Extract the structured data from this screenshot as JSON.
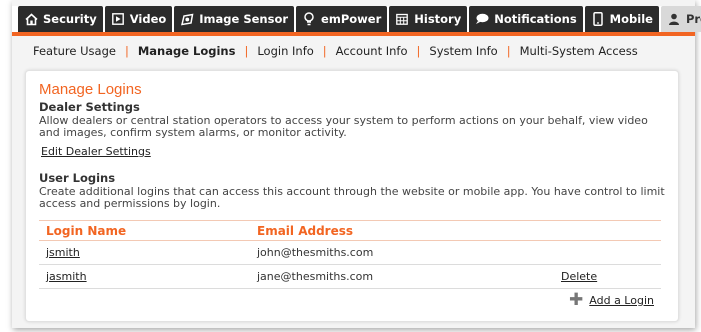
{
  "tabs": [
    {
      "label": "Security",
      "icon": "home-icon",
      "active": false
    },
    {
      "label": "Video",
      "icon": "play-icon",
      "active": false
    },
    {
      "label": "Image Sensor",
      "icon": "camera-icon",
      "active": false
    },
    {
      "label": "emPower",
      "icon": "bulb-icon",
      "active": false
    },
    {
      "label": "History",
      "icon": "calendar-icon",
      "active": false
    },
    {
      "label": "Notifications",
      "icon": "chat-bubble-icon",
      "active": false
    },
    {
      "label": "Mobile",
      "icon": "phone-icon",
      "active": false
    },
    {
      "label": "Profile",
      "icon": "person-icon",
      "active": true
    }
  ],
  "subnav": [
    {
      "label": "Feature Usage",
      "active": false
    },
    {
      "label": "Manage Logins",
      "active": true
    },
    {
      "label": "Login Info",
      "active": false
    },
    {
      "label": "Account Info",
      "active": false
    },
    {
      "label": "System Info",
      "active": false
    },
    {
      "label": "Multi-System Access",
      "active": false
    }
  ],
  "page": {
    "title": "Manage Logins",
    "dealer": {
      "heading": "Dealer Settings",
      "description": "Allow dealers or central station operators to access your system to perform actions on your behalf, view video and images, confirm system alarms, or monitor activity.",
      "edit_link": "Edit Dealer Settings"
    },
    "users": {
      "heading": "User Logins",
      "description": "Create additional logins that can access this account through the website or mobile app. You have control to limit access and permissions by login."
    }
  },
  "table": {
    "headers": [
      "Login Name",
      "Email Address",
      ""
    ],
    "rows": [
      {
        "login": "jsmith",
        "email": "john@thesmiths.com",
        "action": ""
      },
      {
        "login": "jasmith",
        "email": "jane@thesmiths.com",
        "action": "Delete"
      }
    ]
  },
  "add_login_label": "Add a Login",
  "colors": {
    "accent": "#f26522",
    "tab_bg": "#2b2b2b",
    "tab_active_bg": "#d9d9d9"
  }
}
